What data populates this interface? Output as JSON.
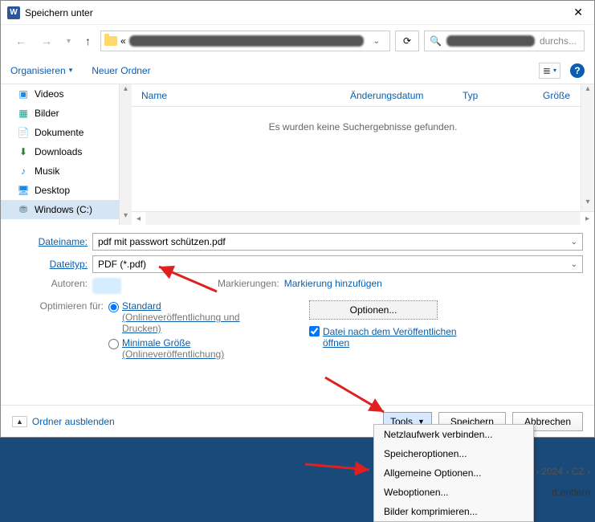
{
  "titlebar": {
    "title": "Speichern unter"
  },
  "nav": {
    "addr_truncation": "«",
    "search_hint": "durchs..."
  },
  "toolbar": {
    "organize": "Organisieren",
    "new_folder": "Neuer Ordner"
  },
  "tree": {
    "items": [
      {
        "label": "Videos",
        "icon": "videos-icon"
      },
      {
        "label": "Bilder",
        "icon": "pictures-icon"
      },
      {
        "label": "Dokumente",
        "icon": "documents-icon"
      },
      {
        "label": "Downloads",
        "icon": "downloads-icon"
      },
      {
        "label": "Musik",
        "icon": "music-icon"
      },
      {
        "label": "Desktop",
        "icon": "desktop-icon"
      },
      {
        "label": "Windows (C:)",
        "icon": "drive-icon"
      }
    ]
  },
  "columns": {
    "name": "Name",
    "modified": "Änderungsdatum",
    "type": "Typ",
    "size": "Größe"
  },
  "list": {
    "no_results": "Es wurden keine Suchergebnisse gefunden."
  },
  "form": {
    "filename_label": "Dateiname:",
    "filename_value": "pdf mit passwort schützen.pdf",
    "filetype_label": "Dateityp:",
    "filetype_value": "PDF (*.pdf)",
    "authors_label": "Autoren:",
    "tags_label": "Markierungen:",
    "tags_value": "Markierung hinzufügen",
    "optimize_label": "Optimieren für:",
    "radio_standard": "Standard",
    "radio_standard_sub": "(Onlineveröffentlichung und Drucken)",
    "radio_minimal": "Minimale Größe",
    "radio_minimal_sub": "(Onlineveröffentlichung)",
    "options_btn": "Optionen...",
    "open_after": "Datei nach dem Veröffentlichen öffnen"
  },
  "footer": {
    "hide_folders": "Ordner ausblenden",
    "tools": "Tools",
    "save": "Speichern",
    "cancel": "Abbrechen"
  },
  "tools_menu": {
    "items": [
      "Netzlaufwerk verbinden...",
      "Speicheroptionen...",
      "Allgemeine Optionen...",
      "Weboptionen...",
      "Bilder komprimieren..."
    ]
  },
  "background": {
    "breadcrumb": "› 2024 › CZ ›",
    "partial": "rt entfern"
  }
}
